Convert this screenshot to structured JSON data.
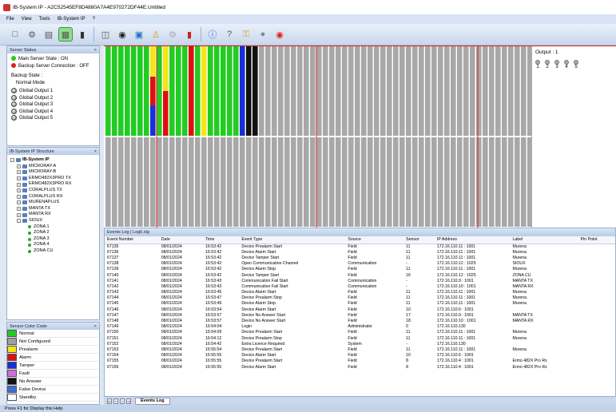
{
  "window": {
    "title": "IB-System IP - A2C52545EF8D4880A7A4E970272DF44E.Untitled"
  },
  "menu": [
    "File",
    "View",
    "Tools",
    "IB-System IP",
    "?"
  ],
  "toolbar": {
    "icons": [
      "new-icon",
      "open-icon",
      "save-icon",
      "grid-view-icon",
      "tag-icon",
      "panel-icon",
      "disc-icon",
      "monitor-icon",
      "lock-icon",
      "settings-icon",
      "bookmark-icon",
      "info-icon",
      "help-icon",
      "key-icon",
      "record-icon",
      "stop-icon"
    ]
  },
  "server_status": {
    "title": "Server Status",
    "main_state": "Main Server State : ON",
    "backup_connection": "Backup Server Connection : OFF",
    "backup_state_label": "Backup State :",
    "backup_state_value": "Normal Mode",
    "global_outputs": [
      "Global Output 1",
      "Global Output 2",
      "Global Output 3",
      "Global Output 4",
      "Global Output 5"
    ],
    "colors": {
      "on": "#22cc22",
      "off": "#dd2222"
    }
  },
  "structure": {
    "title": "IB-System IP Structure",
    "root": "IB-System IP",
    "devices": [
      "MICRORAY-A",
      "MICRORAY-B",
      "ERMO482X3PRO TX",
      "ERMO482X3PRO RX",
      "CORALPLUS TX",
      "CORALPLUS RX",
      "MURENAPLUS",
      "MANTA TX",
      "MANTA RX",
      "SIOUX"
    ],
    "zones": [
      "ZONA 1",
      "ZONA 2",
      "ZONA 3",
      "ZONA 4",
      "ZONA CU"
    ]
  },
  "legend": {
    "title": "Sensor Color Code",
    "items": [
      {
        "label": "Normal",
        "color": "#22cc22"
      },
      {
        "label": "Not Configured",
        "color": "#a0a0a0"
      },
      {
        "label": "Prealarm",
        "color": "#f5e614"
      },
      {
        "label": "Alarm",
        "color": "#e01010"
      },
      {
        "label": "Tamper",
        "color": "#1a2fd6"
      },
      {
        "label": "Fault",
        "color": "#d26be0"
      },
      {
        "label": "No Answer",
        "color": "#111111"
      },
      {
        "label": "False Device",
        "color": "#3b6fd8"
      },
      {
        "label": "Standby",
        "color": "#ffffff"
      }
    ]
  },
  "grid": {
    "columns": [
      [
        "#22cc22",
        "#22cc22",
        "#22cc22",
        "#22cc22",
        "#22cc22",
        "#22cc22",
        "#22cc22",
        "#22cc22",
        "#22cc22",
        "#22cc22",
        "#22cc22",
        "#22cc22",
        "#22cc22",
        "#e01010",
        "#22cc22",
        "#f5e614",
        "#22cc22",
        "#22cc22",
        "#22cc22",
        "#22cc22",
        "#22cc22",
        "#1a2fd6",
        "#111111",
        "#111111"
      ],
      [
        "mid_yellow_top",
        "mid_red",
        "mid_blue"
      ]
    ],
    "out_label": "Output : 1",
    "outputs": [
      "1",
      "2",
      "3",
      "4",
      "5"
    ]
  },
  "events": {
    "title": "Events Log | Log6.xlg",
    "columns": [
      "Event Number",
      "Date",
      "Time",
      "Event Type",
      "Source",
      "Sensor",
      "IP Address",
      "Label",
      "Pin Point"
    ],
    "rows": [
      [
        "67135",
        "08/01/2024",
        "16:53:42",
        "Device Prealarm Start",
        "Field",
        "11",
        "172.16.110.11 : 1001",
        "Murena",
        ""
      ],
      [
        "67136",
        "08/01/2024",
        "16:53:42",
        "Device Alarm Start",
        "Field",
        "11",
        "172.16.110.11 : 1001",
        "Murena",
        ""
      ],
      [
        "67137",
        "08/01/2024",
        "16:53:42",
        "Device Tamper Start",
        "Field",
        "11",
        "172.16.110.11 : 1001",
        "Murena",
        ""
      ],
      [
        "67138",
        "08/01/2024",
        "16:53:42",
        "Open Communication Channel",
        "Communication",
        "-",
        "172.16.110.12 : 1025",
        "SIOUX",
        ""
      ],
      [
        "67139",
        "08/01/2024",
        "16:53:42",
        "Device Alarm Stop",
        "Field",
        "11",
        "172.16.110.11 : 1001",
        "Murena",
        ""
      ],
      [
        "67140",
        "08/01/2024",
        "16:53:42",
        "Device Tamper Start",
        "Field",
        "16",
        "172.16.110.12 : 1025",
        "ZONA CU",
        ""
      ],
      [
        "67141",
        "08/01/2024",
        "16:53:43",
        "Communication Fail  Start",
        "Communication",
        "-",
        "172.16.110.9 : 1001",
        "MANTA TX",
        ""
      ],
      [
        "67142",
        "08/01/2024",
        "16:53:43",
        "Communication Fail  Start",
        "Communication",
        "-",
        "172.16.110.10 : 1001",
        "MANTA RX",
        ""
      ],
      [
        "67143",
        "08/01/2024",
        "16:53:45",
        "Device Alarm Start",
        "Field",
        "11",
        "172.16.110.11 : 1001",
        "Murena",
        ""
      ],
      [
        "67144",
        "08/01/2024",
        "16:53:47",
        "Device Prealarm Stop",
        "Field",
        "11",
        "172.16.110.11 : 1001",
        "Murena",
        ""
      ],
      [
        "67145",
        "08/01/2024",
        "16:53:49",
        "Device Alarm Stop",
        "Field",
        "11",
        "172.16.110.11 : 1001",
        "Murena",
        ""
      ],
      [
        "67146",
        "08/01/2024",
        "16:53:54",
        "Device Alarm Start",
        "Field",
        "10",
        "172.16.110.6 : 1001",
        "",
        ""
      ],
      [
        "67147",
        "08/01/2024",
        "16:53:57",
        "Device No Answer Start",
        "Field",
        "17",
        "172.16.110.9 : 1001",
        "MANTA TX",
        ""
      ],
      [
        "67148",
        "08/01/2024",
        "16:53:57",
        "Device No Answer Start",
        "Field",
        "18",
        "172.16.110.10 : 1001",
        "MANTA RX",
        ""
      ],
      [
        "67149",
        "08/01/2024",
        "16:54:04",
        "Login",
        "Administrator",
        "0",
        "172.16.110.130",
        "",
        ""
      ],
      [
        "67150",
        "08/01/2024",
        "16:54:09",
        "Device Prealarm Start",
        "Field",
        "11",
        "172.16.110.11 : 1001",
        "Murena",
        ""
      ],
      [
        "67151",
        "08/01/2024",
        "16:54:12",
        "Device Prealarm Stop",
        "Field",
        "11",
        "172.16.110.11 : 1001",
        "Murena",
        ""
      ],
      [
        "67152",
        "08/01/2024",
        "16:54:42",
        "Extra Licence Required",
        "System",
        "-",
        "172.16.110.130",
        "",
        ""
      ],
      [
        "67153",
        "08/01/2024",
        "16:55:54",
        "Device Prealarm Start",
        "Field",
        "11",
        "172.16.110.11 : 1001",
        "Murena",
        ""
      ],
      [
        "67154",
        "08/01/2024",
        "16:55:55",
        "Device Alarm Start",
        "Field",
        "10",
        "172.16.110.6 : 1001",
        "",
        ""
      ],
      [
        "67155",
        "08/01/2024",
        "16:55:55",
        "Device Prealarm Start",
        "Field",
        "8",
        "172.16.110.4 : 1001",
        "Ermo 482X Pro Rx",
        ""
      ],
      [
        "67156",
        "08/01/2024",
        "16:55:55",
        "Device Alarm Start",
        "Field",
        "8",
        "172.16.110.4 : 1001",
        "Ermo 482X Pro Rx",
        ""
      ]
    ]
  },
  "tabs": {
    "nav": [
      "|<",
      "<",
      ">",
      ">|"
    ],
    "active": "Events Log"
  },
  "statusbar": {
    "text": "Press F1 for Display this Help"
  }
}
